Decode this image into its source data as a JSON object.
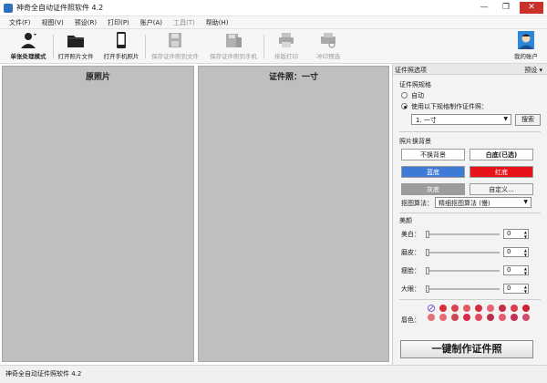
{
  "window": {
    "title": "神奇全自动证件照软件 4.2",
    "controls": [
      "—",
      "❐",
      "✕"
    ]
  },
  "menu": [
    {
      "label": "文件(F)",
      "enabled": true
    },
    {
      "label": "视图(V)",
      "enabled": true
    },
    {
      "label": "预设(R)",
      "enabled": true
    },
    {
      "label": "打印(P)",
      "enabled": true
    },
    {
      "label": "账户(A)",
      "enabled": true
    },
    {
      "label": "工具(T)",
      "enabled": false
    },
    {
      "label": "帮助(H)",
      "enabled": true
    }
  ],
  "toolbar": {
    "single_mode": "单张处理模式",
    "open_file": "打开照片文件",
    "open_phone": "打开手机照片",
    "save_file": "保存证件照到文件",
    "save_phone": "保存证件照到手机",
    "layout_print": "排版打印",
    "print_preview": "冲印预选",
    "account": "我的账户"
  },
  "panels": {
    "original_title": "原照片",
    "id_title": "证件照：一寸"
  },
  "options": {
    "header": "证件照选项",
    "preset": "预设 ▾",
    "spec_title": "证件照规格",
    "radio_auto": "自动",
    "radio_custom": "使用以下规格制作证件照：",
    "spec_value": "1. 一寸",
    "search_button": "搜索",
    "bg_title": "照片换背景",
    "bg_buttons": [
      {
        "label": "不换背景",
        "color": "#ffffff",
        "text": "#1a1a1a",
        "bold": false
      },
      {
        "label": "白底(已选)",
        "color": "#ffffff",
        "text": "#1a1a1a",
        "bold": true
      },
      {
        "label": "蓝底",
        "color": "#3d7bd6",
        "text": "#ffffff",
        "bold": false
      },
      {
        "label": "红底",
        "color": "#e8131a",
        "text": "#ffffff",
        "bold": false
      },
      {
        "label": "灰底",
        "color": "#9c9c9c",
        "text": "#ffffff",
        "bold": false
      },
      {
        "label": "自定义...",
        "color": "#f4f4f4",
        "text": "#1a1a1a",
        "bold": false
      }
    ],
    "algo_label": "抠图算法：",
    "algo_value": "精细抠图算法 (慢)",
    "beauty_title": "美颜",
    "sliders": [
      {
        "label": "美白：",
        "value": "0"
      },
      {
        "label": "磨皮：",
        "value": "0"
      },
      {
        "label": "瘦脸：",
        "value": "0"
      },
      {
        "label": "大眼：",
        "value": "0"
      }
    ],
    "lip_label": "唇色：",
    "lip_colors": [
      "none",
      "#d6303b",
      "#d84451",
      "#e05a64",
      "#d0303e",
      "#e36470",
      "#c92f43",
      "#d83c4e",
      "#cf2136",
      "#e0707a",
      "#e86b7a",
      "#cc4858",
      "#d7284a",
      "#e04b61",
      "#b82f4d",
      "#e65a6f",
      "#c62e55",
      "#d24a6d"
    ],
    "generate_button": "一键制作证件照"
  },
  "status": "神奇全自动证件照软件 4.2"
}
